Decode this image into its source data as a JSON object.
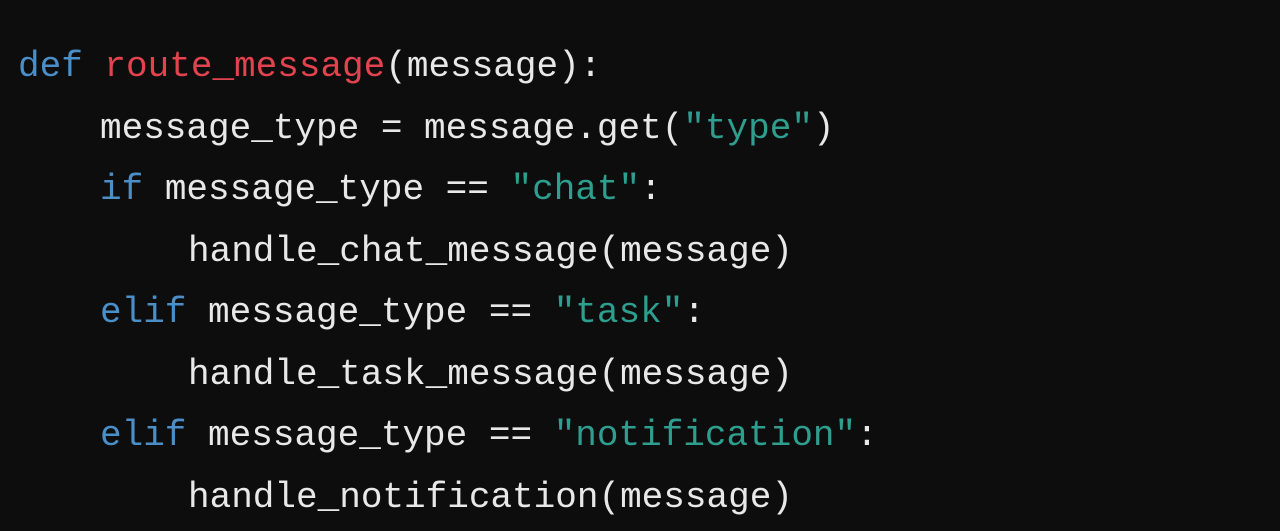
{
  "colors": {
    "background": "#0d0d0e",
    "keyword": "#4a8fc8",
    "function_name": "#e3434e",
    "string": "#2e9e8e",
    "plain": "#e8e8e8"
  },
  "code": {
    "language": "python",
    "lines": [
      {
        "def": "def",
        "space": " ",
        "name": "route_message",
        "rest": "(message):"
      },
      {
        "pre": "message_type = message.get(",
        "str": "\"type\"",
        "post": ")"
      },
      {
        "kw": "if",
        "pre": " message_type == ",
        "str": "\"chat\"",
        "post": ":"
      },
      {
        "text": "handle_chat_message(message)"
      },
      {
        "kw": "elif",
        "pre": " message_type == ",
        "str": "\"task\"",
        "post": ":"
      },
      {
        "text": "handle_task_message(message)"
      },
      {
        "kw": "elif",
        "pre": " message_type == ",
        "str": "\"notification\"",
        "post": ":"
      },
      {
        "text": "handle_notification(message)"
      }
    ]
  }
}
